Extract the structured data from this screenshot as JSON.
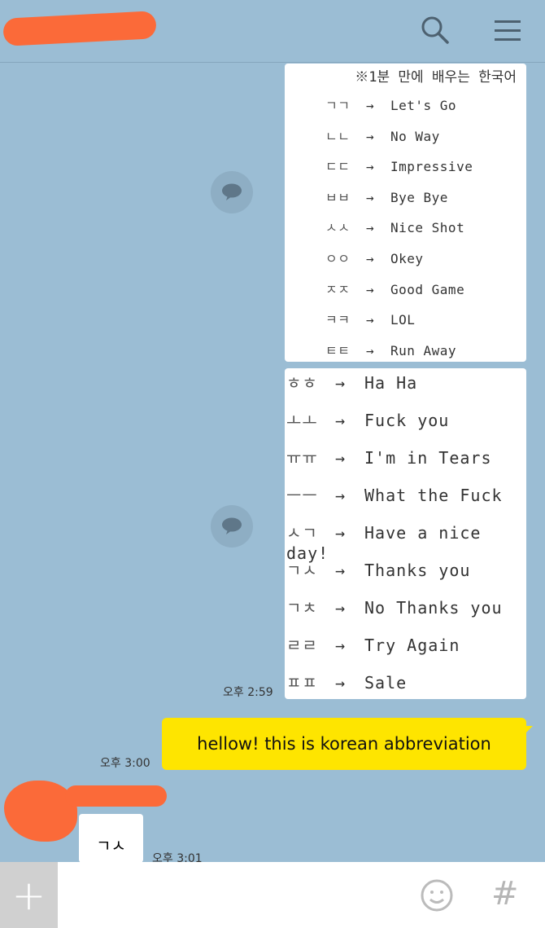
{
  "header": {
    "icons": [
      "back-icon",
      "search-icon",
      "menu-icon"
    ]
  },
  "messages": {
    "card1": {
      "title": "※1분 만에 배우는 한국어",
      "rows": [
        {
          "ko": "ㄱㄱ",
          "en": "Let's Go"
        },
        {
          "ko": "ㄴㄴ",
          "en": "No Way"
        },
        {
          "ko": "ㄷㄷ",
          "en": "Impressive"
        },
        {
          "ko": "ㅂㅂ",
          "en": "Bye Bye"
        },
        {
          "ko": "ㅅㅅ",
          "en": "Nice Shot"
        },
        {
          "ko": "ㅇㅇ",
          "en": "Okey"
        },
        {
          "ko": "ㅈㅈ",
          "en": "Good Game"
        },
        {
          "ko": "ㅋㅋ",
          "en": "LOL"
        },
        {
          "ko": "ㅌㅌ",
          "en": "Run Away"
        }
      ]
    },
    "card2": {
      "rows": [
        {
          "ko": "ㅎㅎ",
          "en": "Ha Ha"
        },
        {
          "ko": "ㅗㅗ",
          "en": "Fuck you"
        },
        {
          "ko": "ㅠㅠ",
          "en": "I'm in Tears"
        },
        {
          "ko": "ㅡㅡ",
          "en": "What the Fuck"
        },
        {
          "ko": "ㅅㄱ",
          "en": "Have a nice day!"
        },
        {
          "ko": "ㄱㅅ",
          "en": "Thanks you"
        },
        {
          "ko": "ㄱㅊ",
          "en": "No Thanks you"
        },
        {
          "ko": "ㄹㄹ",
          "en": "Try Again"
        },
        {
          "ko": "ㅍㅍ",
          "en": "Sale"
        }
      ],
      "time": "오후 2:59"
    },
    "arrow": "→",
    "my_message": {
      "text": "hellow! this is korean abbreviation",
      "time": "오후 3:00"
    },
    "their_message": {
      "text": "ㄱㅅ",
      "time": "오후 3:01"
    }
  },
  "input_bar": {
    "plus": "+",
    "hash": "#"
  },
  "colors": {
    "background": "#9bbdd4",
    "my_bubble": "#fee500",
    "redaction": "#fb6a39"
  }
}
